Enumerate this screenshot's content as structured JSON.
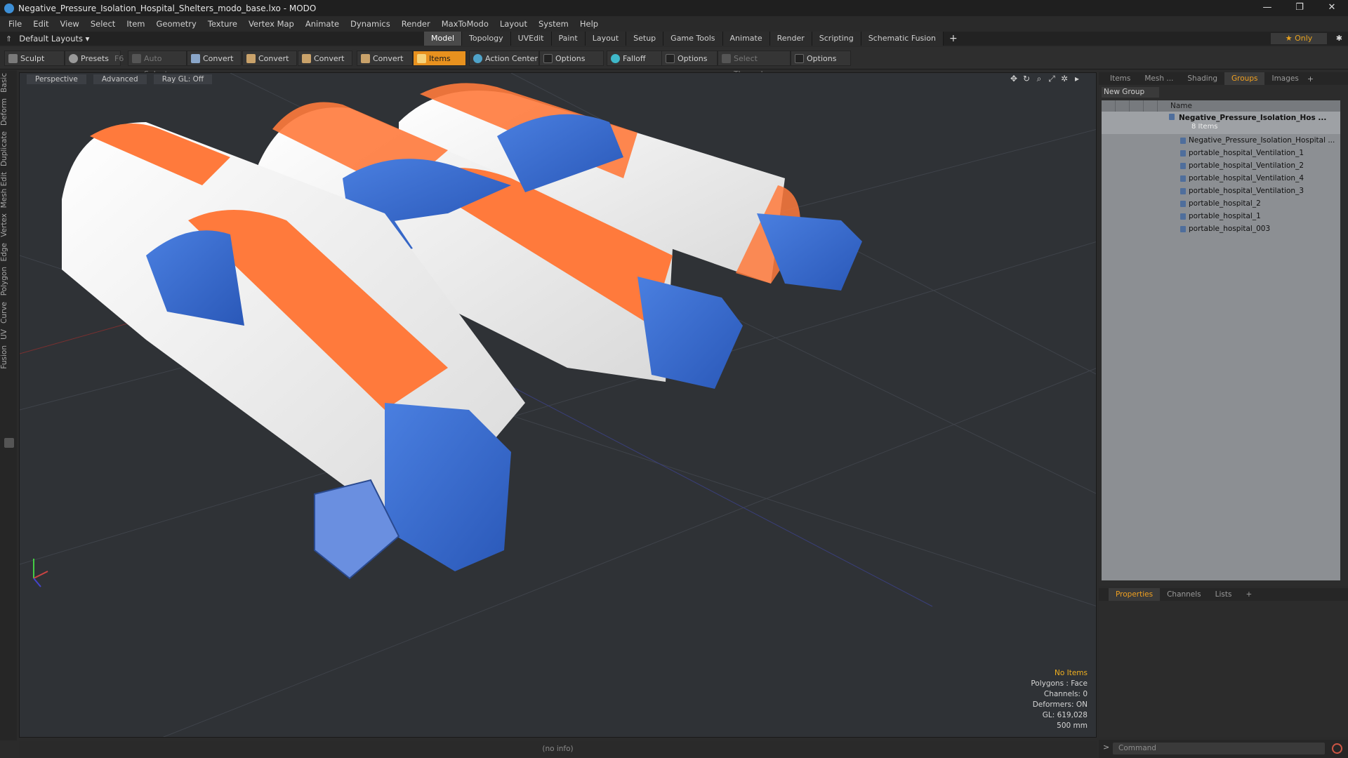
{
  "window": {
    "title": "Negative_Pressure_Isolation_Hospital_Shelters_modo_base.lxo - MODO",
    "controls": [
      "—",
      "❐",
      "✕"
    ]
  },
  "menu": [
    "File",
    "Edit",
    "View",
    "Select",
    "Item",
    "Geometry",
    "Texture",
    "Vertex Map",
    "Animate",
    "Dynamics",
    "Render",
    "MaxToModo",
    "Layout",
    "System",
    "Help"
  ],
  "layoutbar": {
    "layout": "Default Layouts ▾",
    "tabs": [
      "Model",
      "Topology",
      "UVEdit",
      "Paint",
      "Layout",
      "Setup",
      "Game Tools",
      "Animate",
      "Render",
      "Scripting",
      "Schematic Fusion"
    ],
    "active_tab": "Model",
    "only": "★  Only"
  },
  "toolbar": {
    "sculpt": "Sculpt",
    "presets": "Presets",
    "presets_key": "F6",
    "auto_select": "Auto Select",
    "convert1": "Convert",
    "convert2": "Convert",
    "convert3": "Convert",
    "convert4": "Convert",
    "items": "Items",
    "action_center": "Action Center",
    "options1": "Options",
    "falloff": "Falloff",
    "options2": "Options",
    "select_through": "Select Through",
    "options3": "Options"
  },
  "left_tabs": [
    "Basic",
    "Deform",
    "Duplicate",
    "Mesh Edit",
    "Vertex",
    "Edge",
    "Polygon",
    "Curve",
    "UV",
    "Fusion"
  ],
  "viewport": {
    "view": "Perspective",
    "shading": "Advanced",
    "raygl": "Ray GL: Off",
    "info": {
      "items": "No Items",
      "polygons": "Polygons : Face",
      "channels": "Channels: 0",
      "deformers": "Deformers: ON",
      "gl": "GL: 619,028",
      "scale": "500 mm"
    }
  },
  "outliner": {
    "tabs": [
      "Items",
      "Mesh ...",
      "Shading",
      "Groups",
      "Images"
    ],
    "active_tab": "Groups",
    "new_group": "New Group",
    "column_name": "Name",
    "root": {
      "name": "Negative_Pressure_Isolation_Hos ...",
      "count": "8 Items"
    },
    "children": [
      "Negative_Pressure_Isolation_Hospital ...",
      "portable_hospital_Ventilation_1",
      "portable_hospital_Ventilation_2",
      "portable_hospital_Ventilation_4",
      "portable_hospital_Ventilation_3",
      "portable_hospital_2",
      "portable_hospital_1",
      "portable_hospital_003"
    ]
  },
  "properties": {
    "tabs": [
      "Properties",
      "Channels",
      "Lists"
    ],
    "active_tab": "Properties"
  },
  "status": "(no info)",
  "command": {
    "placeholder": "Command"
  },
  "colors": {
    "accent": "#e8911e",
    "tent_orange": "#ff7a3c",
    "tent_blue": "#3a6fd2",
    "tent_white": "#f2f2f2"
  }
}
